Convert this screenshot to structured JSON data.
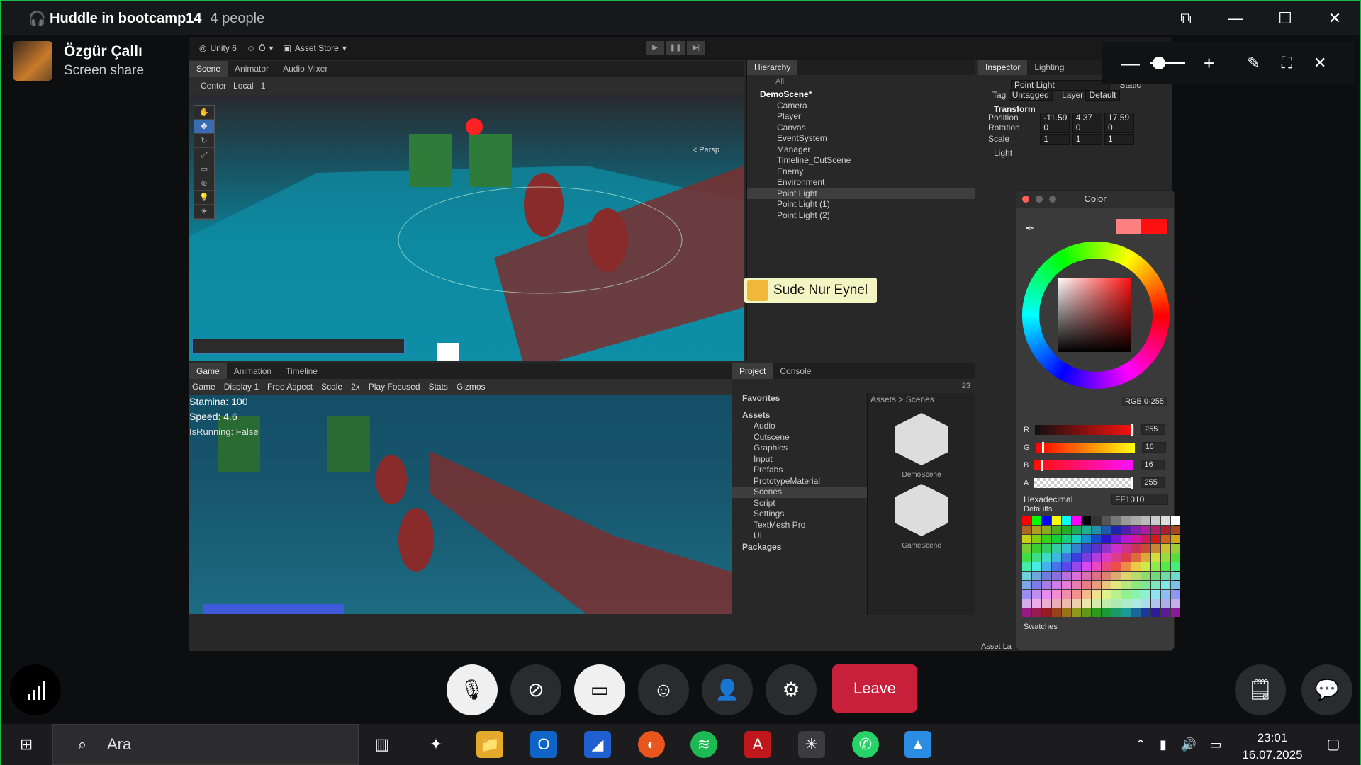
{
  "huddle": {
    "title": "Huddle in bootcamp14",
    "people": "4 people"
  },
  "presenter": {
    "name": "Özgür Çallı",
    "mode": "Screen share"
  },
  "unity": {
    "version": "Unity 6",
    "account": "Ö",
    "asset_store": "Asset Store",
    "scene_tabs": [
      "Scene",
      "Animator",
      "Audio Mixer"
    ],
    "scene_tools": {
      "pivot": "Center",
      "space": "Local",
      "snap": "1"
    },
    "persp": "< Persp",
    "hierarchy_tab": "Hierarchy",
    "hierarchy_search": "All",
    "scene_name": "DemoScene*",
    "hierarchy_items": [
      "Camera",
      "Player",
      "Canvas",
      "EventSystem",
      "Manager",
      "Timeline_CutScene",
      "Enemy",
      "Environment",
      "Point Light",
      "Point Light (1)",
      "Point Light (2)"
    ],
    "inspector_tabs": [
      "Inspector",
      "Lighting"
    ],
    "object_name": "Point Light",
    "static_label": "Static",
    "tag_label": "Tag",
    "tag_value": "Untagged",
    "layer_label": "Layer",
    "layer_value": "Default",
    "transform_label": "Transform",
    "position_label": "Position",
    "rotation_label": "Rotation",
    "scale_label": "Scale",
    "position": [
      "-11.59",
      "4.37",
      "17.59"
    ],
    "rotation": [
      "0",
      "0",
      "0"
    ],
    "scale": [
      "1",
      "1",
      "1"
    ],
    "light_label": "Light",
    "asset_label": "Asset La",
    "game_tabs": [
      "Game",
      "Animation",
      "Timeline"
    ],
    "game_bar": {
      "mode": "Game",
      "display": "Display 1",
      "aspect": "Free Aspect",
      "scale_label": "Scale",
      "scale_value": "2x",
      "play_mode": "Play Focused",
      "stats": "Stats",
      "gizmos": "Gizmos"
    },
    "hud": [
      "Stamina: 100",
      "Speed: 4.6",
      "IsRunning: False"
    ],
    "project_tabs": [
      "Project",
      "Console"
    ],
    "project_count": "23",
    "favorites": "Favorites",
    "assets_root": "Assets",
    "asset_folders": [
      "Audio",
      "Cutscene",
      "Graphics",
      "Input",
      "Prefabs",
      "PrototypeMaterial",
      "Scenes",
      "Script",
      "Settings",
      "TextMesh Pro",
      "UI"
    ],
    "packages": "Packages",
    "breadcrumb": "Assets > Scenes",
    "scene_assets": [
      "DemoScene",
      "GameScene"
    ]
  },
  "annotation_label": "Sude Nur Eynel",
  "color_picker": {
    "title": "Color",
    "mode": "RGB 0-255",
    "channels": [
      {
        "label": "R",
        "value": "255",
        "fraction": 1.0
      },
      {
        "label": "G",
        "value": "16",
        "fraction": 0.063
      },
      {
        "label": "B",
        "value": "16",
        "fraction": 0.063
      },
      {
        "label": "A",
        "value": "255",
        "fraction": 1.0
      }
    ],
    "hex_label": "Hexadecimal",
    "hex_value": "FF1010",
    "defaults_label": "Defaults",
    "swatches_label": "Swatches",
    "current_color": "#ff1010",
    "previous_color": "#ff8080"
  },
  "controls": {
    "leave": "Leave"
  },
  "taskbar": {
    "search": "Ara",
    "time": "23:01",
    "date": "16.07.2025"
  },
  "colors": {
    "accent_green": "#1bbd4a",
    "leave_red": "#c8203b",
    "unity_selected": "#3a6bb0"
  }
}
